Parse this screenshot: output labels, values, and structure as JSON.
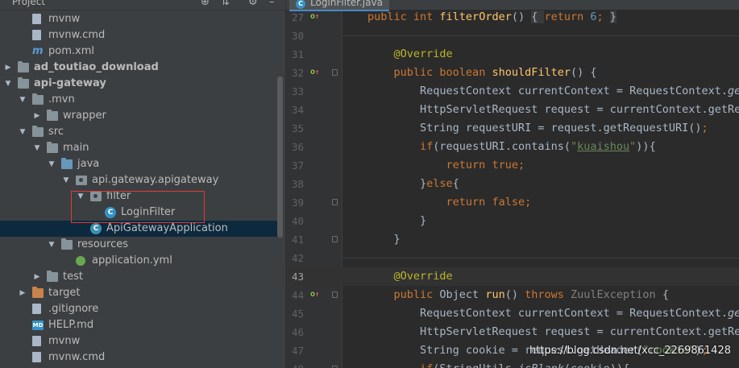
{
  "project_panel": {
    "title": "Project",
    "tree": [
      {
        "label": "mvnw",
        "type": "file",
        "indent": 1
      },
      {
        "label": "mvnw.cmd",
        "type": "file",
        "indent": 1
      },
      {
        "label": "pom.xml",
        "type": "maven",
        "indent": 1
      },
      {
        "label": "ad_toutiao_download",
        "type": "module",
        "indent": 0,
        "bold": true,
        "arrow": "right"
      },
      {
        "label": "api-gateway",
        "type": "module",
        "indent": 0,
        "bold": true,
        "arrow": "down"
      },
      {
        "label": ".mvn",
        "type": "folder",
        "indent": 1,
        "arrow": "down"
      },
      {
        "label": "wrapper",
        "type": "folder",
        "indent": 2,
        "arrow": "right"
      },
      {
        "label": "src",
        "type": "folder",
        "indent": 1,
        "arrow": "down"
      },
      {
        "label": "main",
        "type": "folder",
        "indent": 2,
        "arrow": "down"
      },
      {
        "label": "java",
        "type": "folder-blue",
        "indent": 3,
        "arrow": "down"
      },
      {
        "label": "api.gateway.apigateway",
        "type": "package",
        "indent": 4,
        "arrow": "down"
      },
      {
        "label": "filter",
        "type": "package",
        "indent": 5,
        "arrow": "down"
      },
      {
        "label": "LoginFilter",
        "type": "class",
        "indent": 6
      },
      {
        "label": "ApiGatewayApplication",
        "type": "spring-class",
        "indent": 5,
        "selected": true
      },
      {
        "label": "resources",
        "type": "folder-res",
        "indent": 3,
        "arrow": "down"
      },
      {
        "label": "application.yml",
        "type": "yml",
        "indent": 4
      },
      {
        "label": "test",
        "type": "folder",
        "indent": 2,
        "arrow": "right"
      },
      {
        "label": "target",
        "type": "folder-orange",
        "indent": 1,
        "arrow": "right"
      },
      {
        "label": ".gitignore",
        "type": "file",
        "indent": 1
      },
      {
        "label": "HELP.md",
        "type": "md",
        "indent": 1
      },
      {
        "label": "mvnw",
        "type": "file",
        "indent": 1
      },
      {
        "label": "mvnw.cmd",
        "type": "file",
        "indent": 1
      }
    ]
  },
  "editor": {
    "tab_label": "LoginFilter.java",
    "current_line": "43",
    "lines": [
      {
        "num": "27",
        "marker": "impl",
        "tokens": [
          [
            "kw",
            "public "
          ],
          [
            "kw",
            "int "
          ],
          [
            "fn",
            "filterOrder"
          ],
          [
            "",
            "() "
          ],
          [
            "fold-inline",
            "{ "
          ],
          [
            "kw",
            "return "
          ],
          [
            "num",
            "6"
          ],
          [
            "kw",
            "; "
          ],
          [
            "fold-inline",
            "}"
          ]
        ]
      },
      {
        "num": "30",
        "tokens": []
      },
      {
        "num": "31",
        "tokens": [
          [
            "",
            "    "
          ],
          [
            "ann",
            "@Override"
          ]
        ]
      },
      {
        "num": "32",
        "marker": "override",
        "tokens": [
          [
            "",
            "    "
          ],
          [
            "kw",
            "public "
          ],
          [
            "kw",
            "boolean "
          ],
          [
            "fn",
            "shouldFilter"
          ],
          [
            "",
            "() {"
          ]
        ]
      },
      {
        "num": "33",
        "tokens": [
          [
            "",
            "        RequestContext currentContext = RequestContext."
          ],
          [
            "it",
            "getCurrentContext"
          ]
        ]
      },
      {
        "num": "34",
        "tokens": [
          [
            "",
            "        HttpServletRequest request = currentContext.getRequest();"
          ]
        ]
      },
      {
        "num": "35",
        "tokens": [
          [
            "",
            "        String requestURI = request.getRequestURI()"
          ],
          [
            "kw",
            ";"
          ]
        ]
      },
      {
        "num": "36",
        "tokens": [
          [
            "",
            "        "
          ],
          [
            "kw",
            "if"
          ],
          [
            "",
            "(requestURI.contains("
          ],
          [
            "str",
            "\""
          ],
          [
            "str squig",
            "kuaishou"
          ],
          [
            "str",
            "\""
          ],
          [
            "",
            "))"
          ],
          [
            "",
            "{"
          ]
        ]
      },
      {
        "num": "37",
        "tokens": [
          [
            "",
            "            "
          ],
          [
            "kw",
            "return "
          ],
          [
            "kw",
            "true"
          ],
          [
            "kw",
            ";"
          ]
        ]
      },
      {
        "num": "38",
        "tokens": [
          [
            "",
            "        }"
          ],
          [
            "kw",
            "else"
          ],
          [
            "",
            "{"
          ]
        ]
      },
      {
        "num": "39",
        "tokens": [
          [
            "",
            "            "
          ],
          [
            "kw",
            "return "
          ],
          [
            "kw",
            "false"
          ],
          [
            "kw",
            ";"
          ]
        ]
      },
      {
        "num": "40",
        "tokens": [
          [
            "",
            "        }"
          ]
        ]
      },
      {
        "num": "41",
        "tokens": [
          [
            "",
            "    }"
          ]
        ]
      },
      {
        "num": "42",
        "tokens": []
      },
      {
        "num": "43",
        "tokens": [
          [
            "",
            "    "
          ],
          [
            "ann",
            "@Override"
          ]
        ]
      },
      {
        "num": "44",
        "marker": "override",
        "tokens": [
          [
            "",
            "    "
          ],
          [
            "kw",
            "public "
          ],
          [
            "",
            "Object "
          ],
          [
            "fn",
            "run"
          ],
          [
            "",
            "() "
          ],
          [
            "kw",
            "throws "
          ],
          [
            "gray",
            "ZuulException "
          ],
          [
            "",
            "{"
          ]
        ]
      },
      {
        "num": "45",
        "tokens": [
          [
            "",
            "        RequestContext currentContext = RequestContext."
          ],
          [
            "it",
            "getCurrentContext"
          ]
        ]
      },
      {
        "num": "46",
        "tokens": [
          [
            "",
            "        HttpServletRequest request = currentContext.getRequest();"
          ]
        ]
      },
      {
        "num": "47",
        "tokens": [
          [
            "",
            "        String cookie = request.getHeader("
          ],
          [
            "str",
            "\"cookie\""
          ],
          [
            "",
            ")"
          ],
          [
            "kw",
            ";"
          ]
        ]
      },
      {
        "num": "48",
        "tokens": [
          [
            "",
            "        "
          ],
          [
            "kw",
            "if"
          ],
          [
            "",
            "(StringUtils."
          ],
          [
            "it",
            "isBlank"
          ],
          [
            "",
            "(cookie)){"
          ]
        ]
      }
    ]
  },
  "watermark": "https://blog.csdn.net/xcc_2269861428",
  "colors": {
    "keyword": "#cc7832",
    "annotation": "#bbb529",
    "method": "#ffc66d",
    "string": "#6a8759",
    "number": "#6897bb",
    "highlight_box": "#e03a3a"
  }
}
